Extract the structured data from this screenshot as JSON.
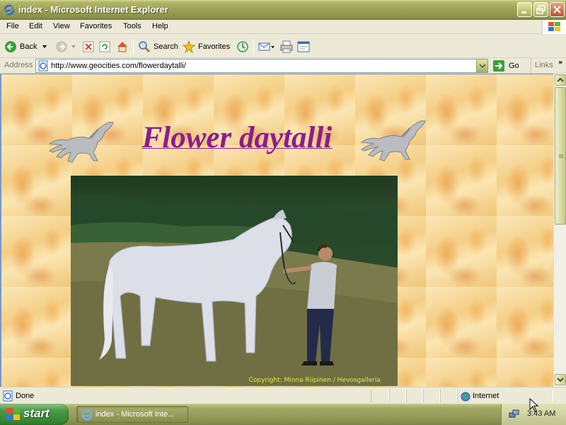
{
  "window": {
    "title": "index - Microsoft Internet Explorer",
    "icon": "ie-icon"
  },
  "menu": [
    "File",
    "Edit",
    "View",
    "Favorites",
    "Tools",
    "Help"
  ],
  "toolbar": {
    "back_label": "Back",
    "search_label": "Search",
    "favorites_label": "Favorites"
  },
  "address": {
    "label": "Address",
    "url": "http://www.geocities.com/flowerdaytalli/",
    "go_label": "Go",
    "links_label": "Links"
  },
  "page": {
    "title": "Flower daytalli",
    "photo_caption": "Copyright: Minna Riipinen / Hevosgalleria",
    "title_color": "#8a1d8e",
    "caption_color": "#e6e84a"
  },
  "status": {
    "text": "Done",
    "zone": "Internet"
  },
  "taskbar": {
    "start_label": "start",
    "task_label": "index - Microsoft Inte...",
    "clock": "3:43 AM"
  }
}
